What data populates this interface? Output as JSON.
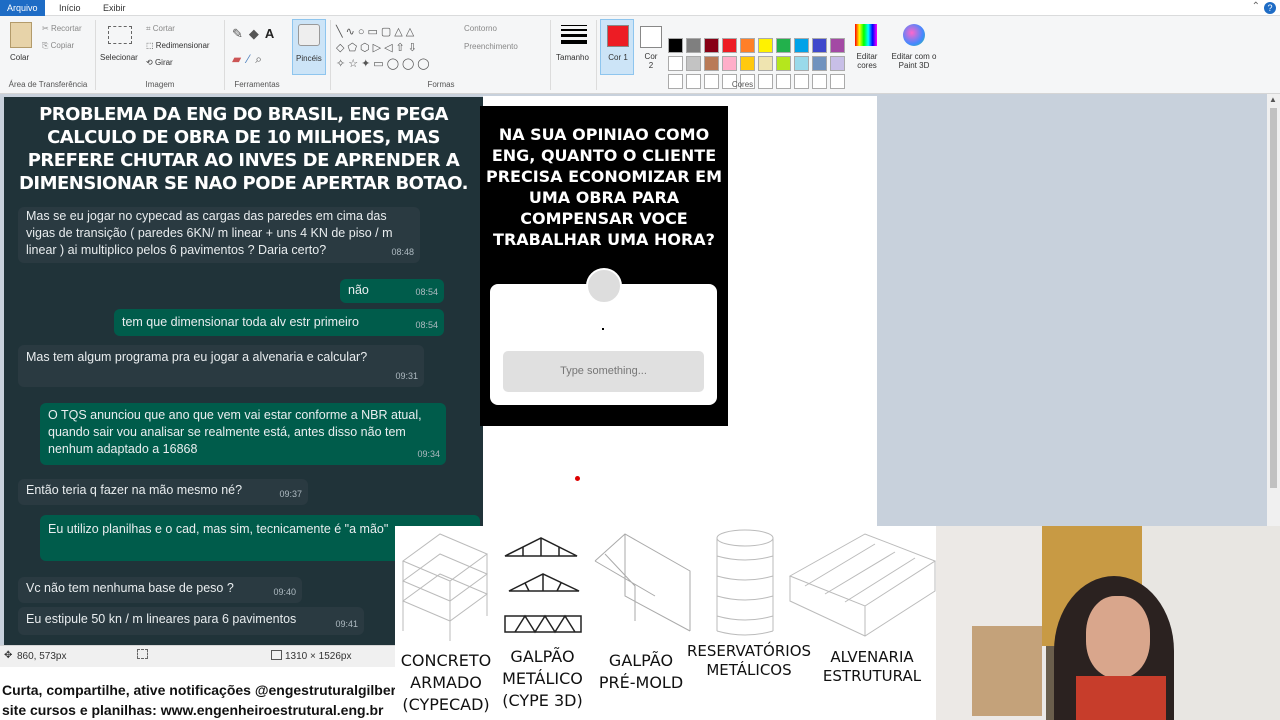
{
  "menu": {
    "tabs": [
      "Arquivo",
      "Início",
      "Exibir"
    ]
  },
  "ribbon": {
    "clipboard": {
      "paste": "Colar",
      "cut": "Recortar",
      "copy": "Copiar",
      "label": "Área de Transferência"
    },
    "image": {
      "select": "Selecionar",
      "crop": "Cortar",
      "resize": "Redimensionar",
      "rotate": "Girar",
      "label": "Imagem"
    },
    "tools": {
      "label": "Ferramentas"
    },
    "brushes": {
      "label": "Pincéis"
    },
    "shapes": {
      "outline": "Contorno",
      "fill": "Preenchimento",
      "label": "Formas"
    },
    "size": {
      "label": "Tamanho"
    },
    "colors": {
      "color1": "Cor 1",
      "color2": "Cor 2",
      "edit": "Editar cores",
      "paint3d": "Editar com o Paint 3D",
      "label": "Cores",
      "palette": [
        "#000000",
        "#7f7f7f",
        "#880015",
        "#ed1c24",
        "#ff7f27",
        "#fff200",
        "#22b14c",
        "#00a2e8",
        "#3f48cc",
        "#a349a4",
        "#ffffff",
        "#c3c3c3",
        "#b97a57",
        "#ffaec9",
        "#ffc90e",
        "#efe4b0",
        "#b5e61d",
        "#99d9ea",
        "#7092be",
        "#c8bfe7"
      ],
      "color1_value": "#ed1c24",
      "color2_value": "#ffffff"
    }
  },
  "chat": {
    "title": "PROBLEMA DA ENG DO BRASIL, ENG PEGA CALCULO DE OBRA DE 10 MILHOES, MAS PREFERE CHUTAR AO INVES DE APRENDER A DIMENSIONAR SE NAO PODE APERTAR BOTAO.",
    "messages": [
      {
        "text": "Mas se eu jogar no cypecad as cargas das paredes em cima das vigas de transição ( paredes 6KN/ m linear + uns 4 KN de piso / m linear ) ai multiplico pelos 6  pavimentos ? Daria certo?",
        "time": "08:48"
      },
      {
        "text": "não",
        "time": "08:54"
      },
      {
        "text": "tem que dimensionar toda alv estr primeiro",
        "time": "08:54"
      },
      {
        "text": "Mas tem algum programa pra eu jogar a alvenaria  e calcular?",
        "time": "09:31"
      },
      {
        "text": "O TQS anunciou que ano que vem vai estar conforme a NBR atual, quando sair vou analisar se realmente está, antes disso não tem nenhum adaptado a 16868",
        "time": "09:34"
      },
      {
        "text": "Então teria q fazer na mão mesmo né?",
        "time": "09:37"
      },
      {
        "text": "Eu utilizo planilhas e o cad, mas sim, tecnicamente é \"a mão\"",
        "time": ""
      },
      {
        "text": "Vc não tem nenhuma base de peso ?",
        "time": "09:40"
      },
      {
        "text": "Eu estipule 50 kn / m lineares para 6 pavimentos",
        "time": "09:41"
      }
    ]
  },
  "story": {
    "question": "NA SUA OPINIAO COMO ENG, QUANTO O CLIENTE PRECISA ECONOMIZAR EM UMA OBRA PARA COMPENSAR VOCE TRABALHAR UMA HORA?",
    "placeholder": "Type something..."
  },
  "status": {
    "cursor": "860, 573px",
    "size": "1310 × 1526px"
  },
  "footer": {
    "line1": "Curta, compartilhe, ative notificações @engestruturalgilberto",
    "line2": "site cursos e planilhas: www.engenheiroestrutural.eng.br"
  },
  "products": [
    {
      "label": "CONCRETO ARMADO (CYPECAD)"
    },
    {
      "label": "GALPÃO METÁLICO (CYPE 3D)"
    },
    {
      "label": "GALPÃO PRÉ-MOLD"
    },
    {
      "label": "RESERVATÓRIOS METÁLICOS"
    },
    {
      "label": "ALVENARIA ESTRUTURAL"
    }
  ]
}
